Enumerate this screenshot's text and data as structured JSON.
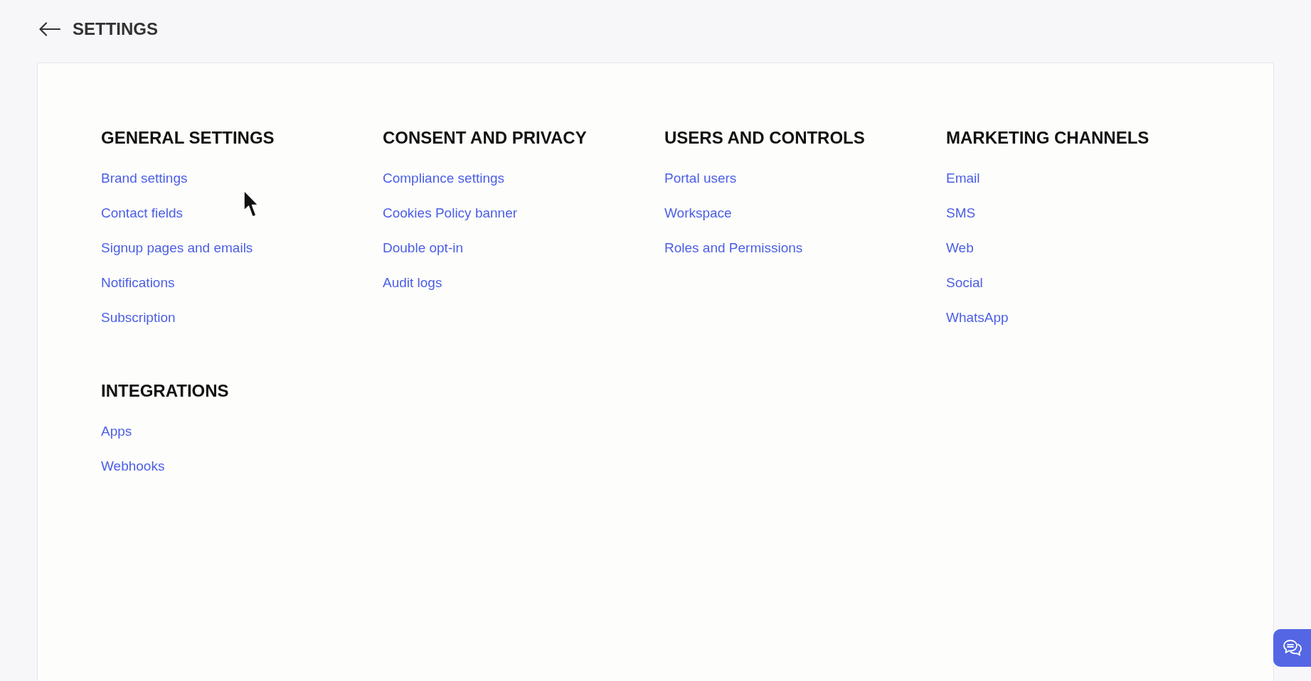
{
  "header": {
    "title": "SETTINGS"
  },
  "sections": [
    {
      "title": "GENERAL SETTINGS",
      "links": [
        "Brand settings",
        "Contact fields",
        "Signup pages and emails",
        "Notifications",
        "Subscription"
      ]
    },
    {
      "title": "CONSENT AND PRIVACY",
      "links": [
        "Compliance settings",
        "Cookies Policy banner",
        "Double opt-in",
        "Audit logs"
      ]
    },
    {
      "title": "USERS AND CONTROLS",
      "links": [
        "Portal users",
        "Workspace",
        "Roles and Permissions"
      ]
    },
    {
      "title": "MARKETING CHANNELS",
      "links": [
        "Email",
        "SMS",
        "Web",
        "Social",
        "WhatsApp"
      ]
    },
    {
      "title": "INTEGRATIONS",
      "links": [
        "Apps",
        "Webhooks"
      ]
    }
  ]
}
